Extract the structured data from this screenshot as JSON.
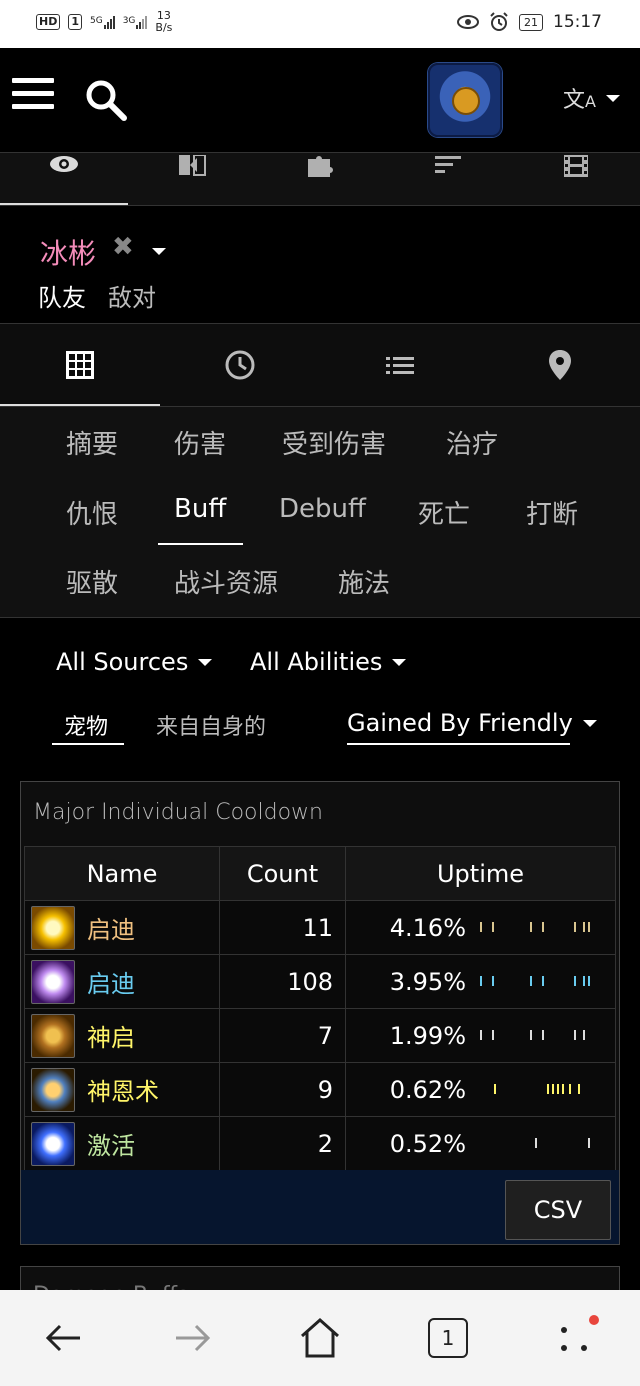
{
  "status_bar": {
    "hd_badge": "HD",
    "sim_slot": "1",
    "signal_1": "5G",
    "signal_2": "3G",
    "net_speed_value": "13",
    "net_speed_unit": "B/s",
    "battery": "21",
    "time": "15:17"
  },
  "header": {
    "menu_icon": "menu-icon",
    "search_icon": "search-icon",
    "logo": "alliance-logo",
    "translate_icon": "translate-icon"
  },
  "top_tabs": [
    {
      "icon": "eye-icon",
      "active": true
    },
    {
      "icon": "compare-icon",
      "active": false
    },
    {
      "icon": "puzzle-icon",
      "active": false
    },
    {
      "icon": "sort-icon",
      "active": false
    },
    {
      "icon": "film-icon",
      "active": false
    }
  ],
  "player": {
    "name": "冰彬",
    "name_color": "#f48cba",
    "close_glyph": "✖",
    "side_ally": "队友",
    "side_enemy": "敌对"
  },
  "view_tabs": [
    {
      "icon": "table-icon",
      "active": true
    },
    {
      "icon": "clock-icon",
      "active": false
    },
    {
      "icon": "list-icon",
      "active": false
    },
    {
      "icon": "location-icon",
      "active": false
    }
  ],
  "categories": {
    "row1": [
      "摘要",
      "伤害",
      "受到伤害",
      "治疗"
    ],
    "row2": [
      "仇恨",
      "Buff",
      "Debuff",
      "死亡",
      "打断"
    ],
    "row3": [
      "驱散",
      "战斗资源",
      "施法"
    ],
    "active": "Buff"
  },
  "filters": {
    "sources": "All Sources",
    "abilities": "All Abilities",
    "pets": "宠物",
    "self": "来自自身的",
    "gained": "Gained By Friendly"
  },
  "table": {
    "title": "Major Individual Cooldown",
    "headers": {
      "name": "Name",
      "count": "Count",
      "uptime": "Uptime"
    },
    "rows": [
      {
        "name": "启迪",
        "name_color": "#f0c080",
        "count": "11",
        "uptime": "4.16%",
        "icon_colors": [
          "#fff9c0",
          "#f6c000",
          "#7a4a00"
        ],
        "tick_color": "#d9c690",
        "ticks": [
          0.0,
          0.1,
          0.42,
          0.52,
          0.78,
          0.86,
          0.9
        ]
      },
      {
        "name": "启迪",
        "name_color": "#69ccf0",
        "count": "108",
        "uptime": "3.95%",
        "icon_colors": [
          "#ffffff",
          "#c08cf0",
          "#3a1060"
        ],
        "tick_color": "#69ccf0",
        "ticks": [
          0.0,
          0.1,
          0.42,
          0.52,
          0.78,
          0.86,
          0.9
        ]
      },
      {
        "name": "神启",
        "name_color": "#fff569",
        "count": "7",
        "uptime": "1.99%",
        "icon_colors": [
          "#f0c050",
          "#b07020",
          "#4a2a00"
        ],
        "tick_color": "#dddddd",
        "ticks": [
          0.0,
          0.1,
          0.42,
          0.52,
          0.78,
          0.86
        ]
      },
      {
        "name": "神恩术",
        "name_color": "#fff569",
        "count": "9",
        "uptime": "0.62%",
        "icon_colors": [
          "#ffd070",
          "#5080c0",
          "#2a1a00"
        ],
        "tick_color": "#fff569",
        "ticks": [
          0.12,
          0.56,
          0.6,
          0.64,
          0.68,
          0.74,
          0.82
        ]
      },
      {
        "name": "激活",
        "name_color": "#bfe6a0",
        "count": "2",
        "uptime": "0.52%",
        "icon_colors": [
          "#ffffff",
          "#4070ff",
          "#0a1a60"
        ],
        "tick_color": "#dddddd",
        "ticks": [
          0.46,
          0.9
        ]
      }
    ],
    "csv_label": "CSV"
  },
  "next_panel": {
    "title": "Damage Buffs"
  },
  "browser_nav": {
    "back_icon": "back-arrow-icon",
    "forward_icon": "forward-arrow-icon",
    "home_icon": "home-icon",
    "tab_count": "1",
    "more_icon": "more-dots-icon"
  }
}
